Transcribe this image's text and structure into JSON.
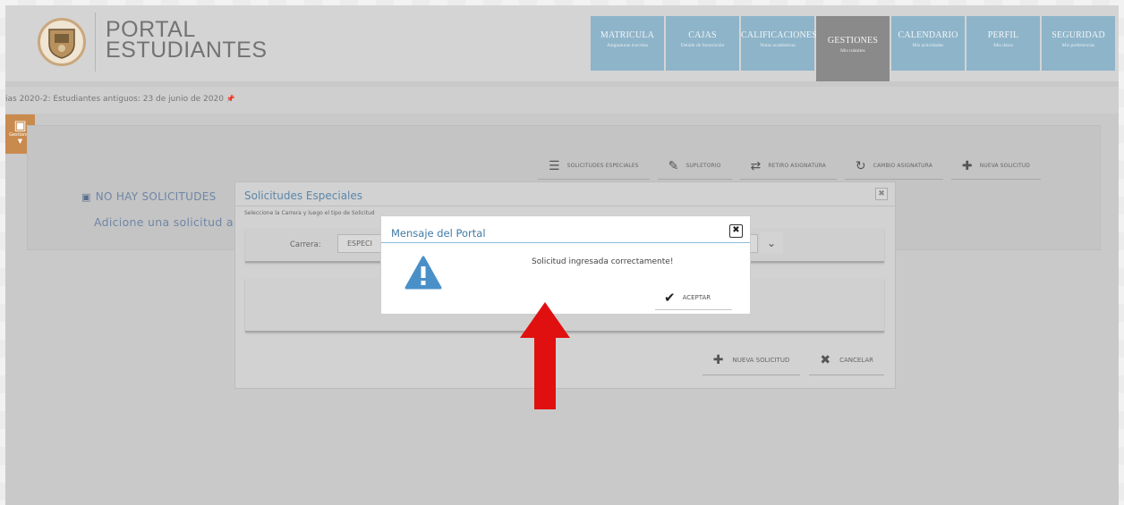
{
  "brand": {
    "line1": "PORTAL",
    "line2": "ESTUDIANTES"
  },
  "nav": [
    {
      "title": "MATRICULA",
      "subtitle": "Asignaturas inscritas"
    },
    {
      "title": "CAJAS",
      "subtitle": "Detalle de facturación"
    },
    {
      "title": "CALIFICACIONES",
      "subtitle": "Notas académicas"
    },
    {
      "title": "GESTIONES",
      "subtitle": "Mis trámites",
      "active": true
    },
    {
      "title": "CALENDARIO",
      "subtitle": "Mis actividades"
    },
    {
      "title": "PERFIL",
      "subtitle": "Mis datos"
    },
    {
      "title": "SEGURIDAD",
      "subtitle": "Mis preferencias"
    }
  ],
  "infobar": {
    "text": "ias 2020-2:   Estudiantes antiguos: 23 de junio de 2020 ",
    "pin": "📌"
  },
  "sidetab": {
    "label": "Gestiones"
  },
  "toolbar": {
    "solicitudes_especiales": "SOLICITUDES ESPECIALES",
    "supletorio": "SUPLETORIO",
    "retiro_asignatura": "RETIRO ASIGNATURA",
    "cambio_asignatura": "CAMBIO ASIGNATURA",
    "nueva_solicitud": "NUEVA SOLICITUD"
  },
  "main": {
    "no_solicitudes": "NO HAY SOLICITUDES",
    "add_hint": "Adicione una solicitud a tra"
  },
  "modal_solicitudes": {
    "title": "Solicitudes Especiales",
    "hint": "Seleccione la Carrera y luego el tipo de Solicitud",
    "carrera_label": "Carrera:",
    "carrera_value": "ESPECI",
    "nueva_solicitud": "NUEVA SOLICITUD",
    "cancelar": "CANCELAR"
  },
  "modal_mensaje": {
    "title": "Mensaje del Portal",
    "message": "Solicitud ingresada correctamente!",
    "accept": "ACEPTAR"
  },
  "colors": {
    "nav": "#8eb4c9",
    "nav_active": "#8a8a8a",
    "sidetab": "#c98a4e",
    "modal_title": "#3f7aa6",
    "warning": "#4a90c8",
    "arrow": "#e01010"
  }
}
